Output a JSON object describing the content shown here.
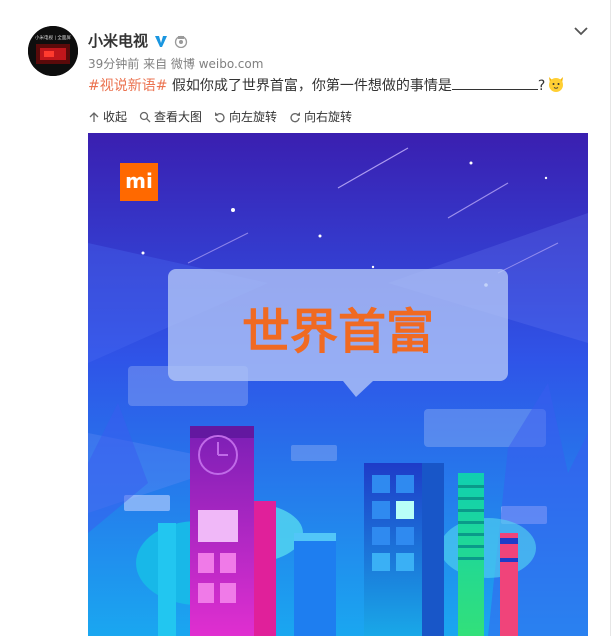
{
  "post": {
    "author": "小米电视",
    "meta": "39分钟前 来自 微博 weibo.com",
    "topic": "#视说新语#",
    "text": " 假如你成了世界首富，你第一件想做的事情是",
    "text_end": "?"
  },
  "toolbar": {
    "collapse": "收起",
    "view_large": "查看大图",
    "rotate_left": "向左旋转",
    "rotate_right": "向右旋转"
  },
  "avatar_caption": "小米电视 | 全面屏",
  "image": {
    "logo_text": "mi",
    "headline": "世界首富"
  },
  "colors": {
    "brand_orange": "#ff6900",
    "topic_orange": "#eb7350"
  },
  "icons": [
    "verified-v-icon",
    "level-badge-icon",
    "chevron-down-icon",
    "arrow-up-icon",
    "search-icon",
    "rotate-left-icon",
    "rotate-right-icon",
    "cat-emoji-icon"
  ]
}
